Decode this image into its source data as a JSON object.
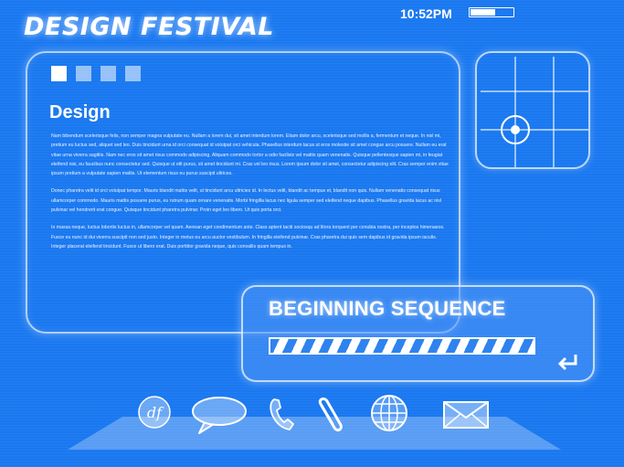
{
  "header": {
    "title": "DESIGN FESTIVAL",
    "time": "10:52PM",
    "battery_level": 0.58
  },
  "document": {
    "tabs": [
      {
        "state": "active"
      },
      {
        "state": "inactive"
      },
      {
        "state": "inactive"
      },
      {
        "state": "inactive"
      }
    ],
    "heading": "Design",
    "paragraphs": [
      "Nam bibendum scelerisque felis, non semper magna vulputate eu. Nullam a lorem dui, sit amet interdum lorem. Etiam dolor arcu, scelerisque sed mollis a, fermentum et neque. In nisl mi, pretium eu luctus sed, aliquet sed leo. Duis tincidunt urna id orci consequat id volutpat orci vehicula. Phasellus interdum lacus ut eros molestie sit amet congue arcu posuere. Nullam eu erat vitae urna viverra sagittis. Nam nec eros sit amet risus commodo adipiscing. Aliquam commodo tortor a odio facilisis vel mattis quam venenatis. Quisque pellentesque sapien mi, in feugiat eleifend nisi, eu faucibus nunc consectetur sed. Quisque ut elit purus, sit amet tincidunt mi. Cras vel leo risus. Lorem ipsum dolor sit amet, consectetur adipiscing elit. Cras semper enim vitae ipsum pretium a vulputate sapien mattis. Ut elementum risus eu purus suscipit ultrices.",
      "Donec pharetra velit id orci volutpat tempor. Mauris blandit mattis velit, ut tincidunt arcu ultricies id. In lectus velit, blandit ac tempus et, blandit non quis. Nullam venenatis consequat risus ullamcorper commodo. Mauris mattis posuere purus, eu rutrum quam ornare venenatis. Morbi fringilla lacus nec ligula semper sed eleifend neque dapibus. Phasellus gravida lacus ac nisl pulvinar vel hendrerit erat congue. Quisque tincidunt pharetra pulvinar. Proin eget leo libero. Ut quis porta orci.",
      "In massa neque, luctus lobortis luctus in, ullamcorper vel quam. Aenean eget condimentum ante. Class aptent taciti sociosqu ad litora torquent per conubia nostra, per inceptos himenaeos. Fusce eu nunc id dui viverra suscipit non sed justo. Integer in metus eu arcu auctor vestibulum. In fringilla eleifend pulvinar. Cras pharetra dui quis sem dapibus id gravida ipsum iaculis. Integer placerat eleifend tincidunt. Fusce ut libero erat. Duis porttitor gravida neque, quis convallis quam tempus in."
    ]
  },
  "sequence": {
    "title": "BEGINNING SEQUENCE",
    "progress": 1.0
  },
  "dock": {
    "items": [
      {
        "icon": "df-logo-icon",
        "text": "df"
      },
      {
        "icon": "speech-bubble-icon"
      },
      {
        "icon": "phone-icon"
      },
      {
        "icon": "paperclip-icon"
      },
      {
        "icon": "globe-icon"
      },
      {
        "icon": "envelope-icon"
      }
    ]
  },
  "colors": {
    "background": "#1a78f0",
    "accent": "#ffffff",
    "stripe": "#2f83ef"
  }
}
